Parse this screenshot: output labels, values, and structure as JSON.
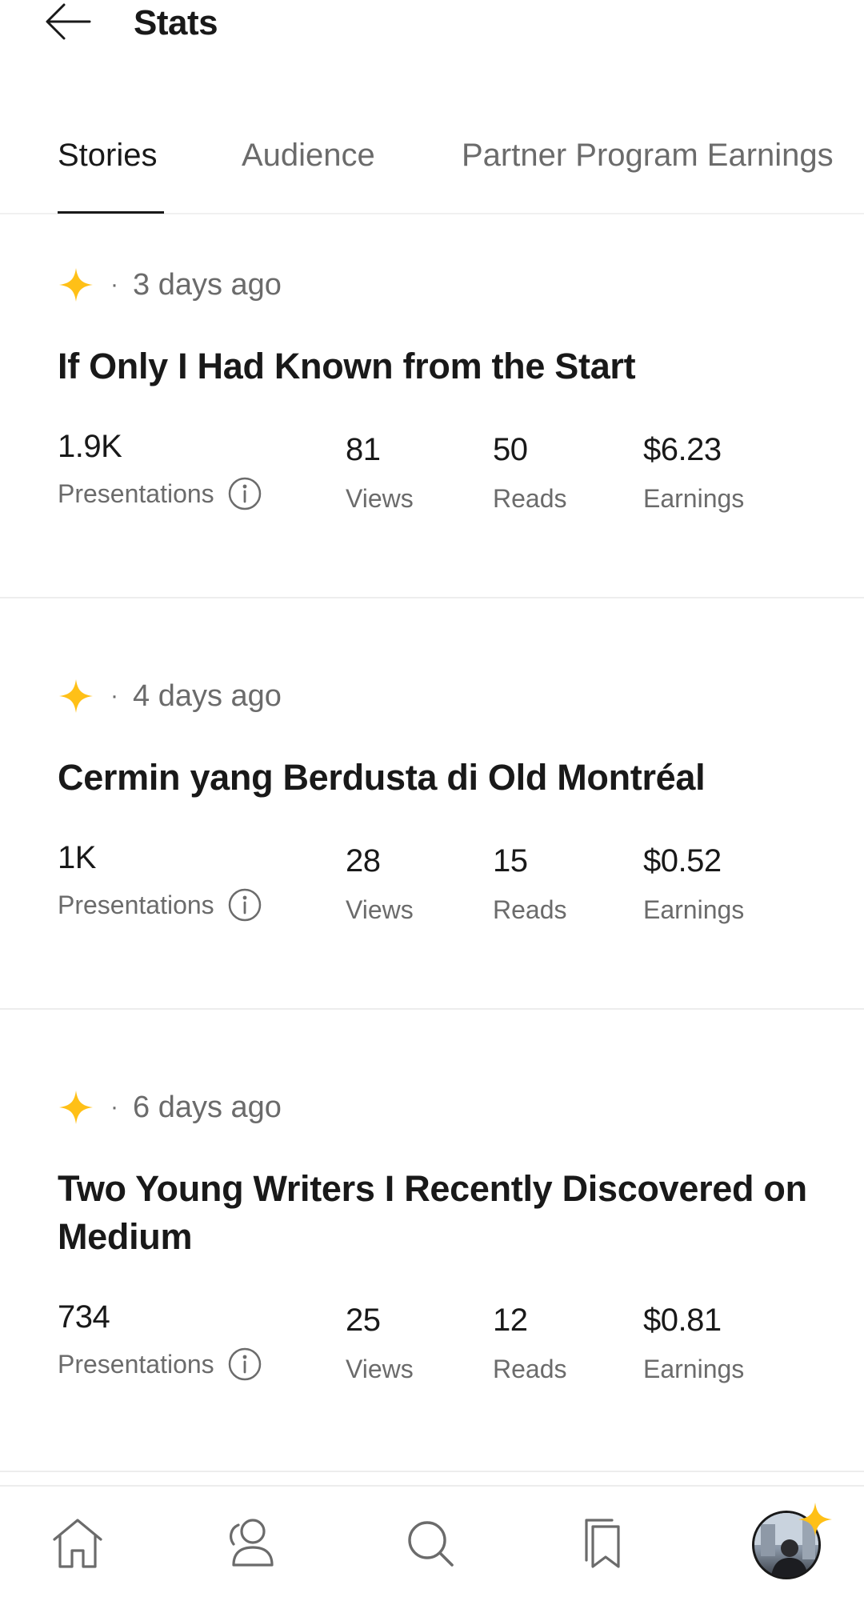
{
  "header": {
    "title": "Stats"
  },
  "tabs": [
    {
      "label": "Stories",
      "active": true
    },
    {
      "label": "Audience",
      "active": false
    },
    {
      "label": "Partner Program Earnings",
      "active": false
    }
  ],
  "stories": [
    {
      "date": "3 days ago",
      "title": "If Only I Had Known from the Start",
      "presentations": "1.9K",
      "views": "81",
      "reads": "50",
      "earnings": "$6.23"
    },
    {
      "date": "4 days ago",
      "title": "Cermin yang Berdusta di Old Montréal",
      "presentations": "1K",
      "views": "28",
      "reads": "15",
      "earnings": "$0.52"
    },
    {
      "date": "6 days ago",
      "title": "Two Young Writers I Recently Discovered on Medium",
      "presentations": "734",
      "views": "25",
      "reads": "12",
      "earnings": "$0.81"
    }
  ],
  "labels": {
    "presentations": "Presentations",
    "views": "Views",
    "reads": "Reads",
    "earnings": "Earnings",
    "separator": "·"
  },
  "colors": {
    "accent_star": "#FFC017",
    "text_primary": "#191919",
    "text_secondary": "#6B6B6B"
  },
  "icons": {
    "back": "arrow-left-icon",
    "member": "star-icon",
    "info": "info-icon",
    "home": "home-icon",
    "following": "profile-people-icon",
    "search": "search-icon",
    "library": "bookmarks-icon"
  }
}
